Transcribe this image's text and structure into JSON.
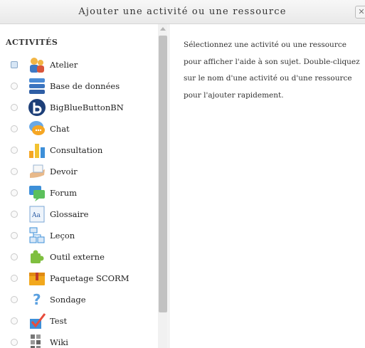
{
  "dialog": {
    "title": "Ajouter une activité ou une ressource",
    "close_label": "✕"
  },
  "activities": {
    "section_title": "ACTIVITÉS",
    "items": [
      {
        "label": "Atelier",
        "icon": "workshop-icon",
        "selected": true
      },
      {
        "label": "Base de données",
        "icon": "database-icon",
        "selected": false
      },
      {
        "label": "BigBlueButtonBN",
        "icon": "bigbluebutton-icon",
        "selected": false
      },
      {
        "label": "Chat",
        "icon": "chat-icon",
        "selected": false
      },
      {
        "label": "Consultation",
        "icon": "choice-icon",
        "selected": false
      },
      {
        "label": "Devoir",
        "icon": "assignment-icon",
        "selected": false
      },
      {
        "label": "Forum",
        "icon": "forum-icon",
        "selected": false
      },
      {
        "label": "Glossaire",
        "icon": "glossary-icon",
        "selected": false
      },
      {
        "label": "Leçon",
        "icon": "lesson-icon",
        "selected": false
      },
      {
        "label": "Outil externe",
        "icon": "external-tool-icon",
        "selected": false
      },
      {
        "label": "Paquetage SCORM",
        "icon": "scorm-icon",
        "selected": false
      },
      {
        "label": "Sondage",
        "icon": "survey-icon",
        "selected": false
      },
      {
        "label": "Test",
        "icon": "quiz-icon",
        "selected": false
      },
      {
        "label": "Wiki",
        "icon": "wiki-icon",
        "selected": false
      }
    ]
  },
  "help": {
    "text": "Sélectionnez une activité ou une ressource pour afficher l'aide à son sujet. Double-cliquez sur le nom d'une activité ou d'une ressource pour l'ajouter rapidement."
  }
}
